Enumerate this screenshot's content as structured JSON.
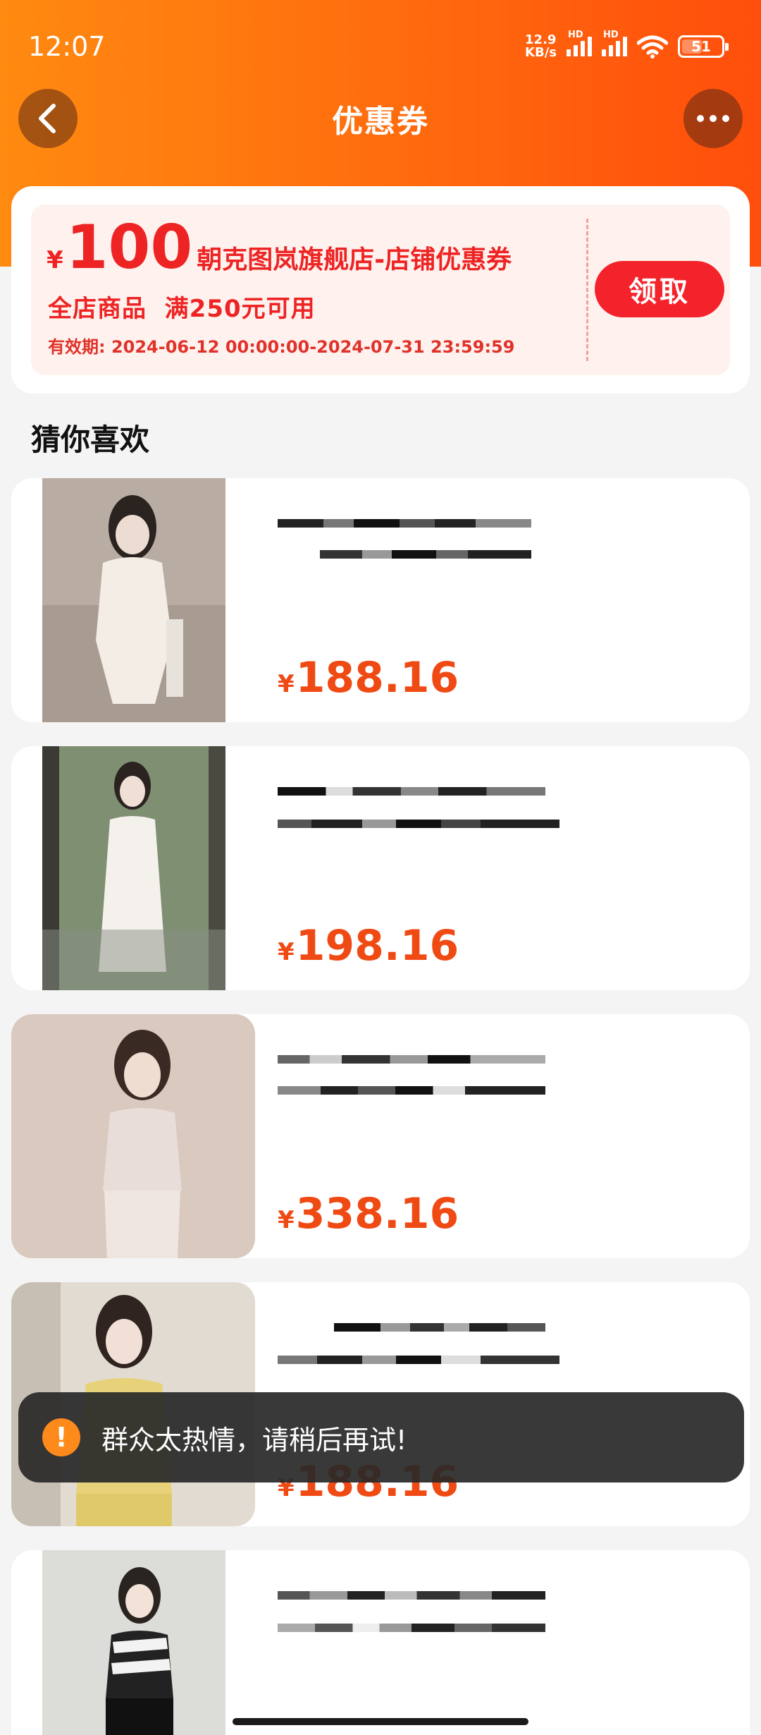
{
  "status_bar": {
    "time": "12:07",
    "net_speed_top": "12.9",
    "net_speed_bottom": "KB/s",
    "hd_label": "HD",
    "battery": "51"
  },
  "nav": {
    "back_icon": "chevron-left-icon",
    "title": "优惠券",
    "more_icon": "more-dots-icon"
  },
  "coupon": {
    "currency": "¥",
    "amount": "100",
    "title": "朝克图岚旗舰店-店铺优惠券",
    "condition": "全店商品  满250元可用",
    "validity": "有效期: 2024-06-12 00:00:00-2024-07-31 23:59:59",
    "claim_label": "领取",
    "colors": {
      "accent": "#ee2424",
      "button": "#f4222a",
      "background": "#fff2ee"
    }
  },
  "recommend": {
    "title": "猜你喜欢",
    "products": [
      {
        "currency": "¥",
        "price": "188.16"
      },
      {
        "currency": "¥",
        "price": "198.16"
      },
      {
        "currency": "¥",
        "price": "338.16"
      },
      {
        "currency": "¥",
        "price": "188.16"
      },
      {
        "currency": "¥",
        "price": ""
      }
    ]
  },
  "toast": {
    "icon": "warning-icon",
    "text": "群众太热情，请稍后再试!"
  },
  "colors": {
    "header_gradient_start": "#ff8a10",
    "header_gradient_end": "#ff4e0c",
    "price": "#f04a14"
  }
}
